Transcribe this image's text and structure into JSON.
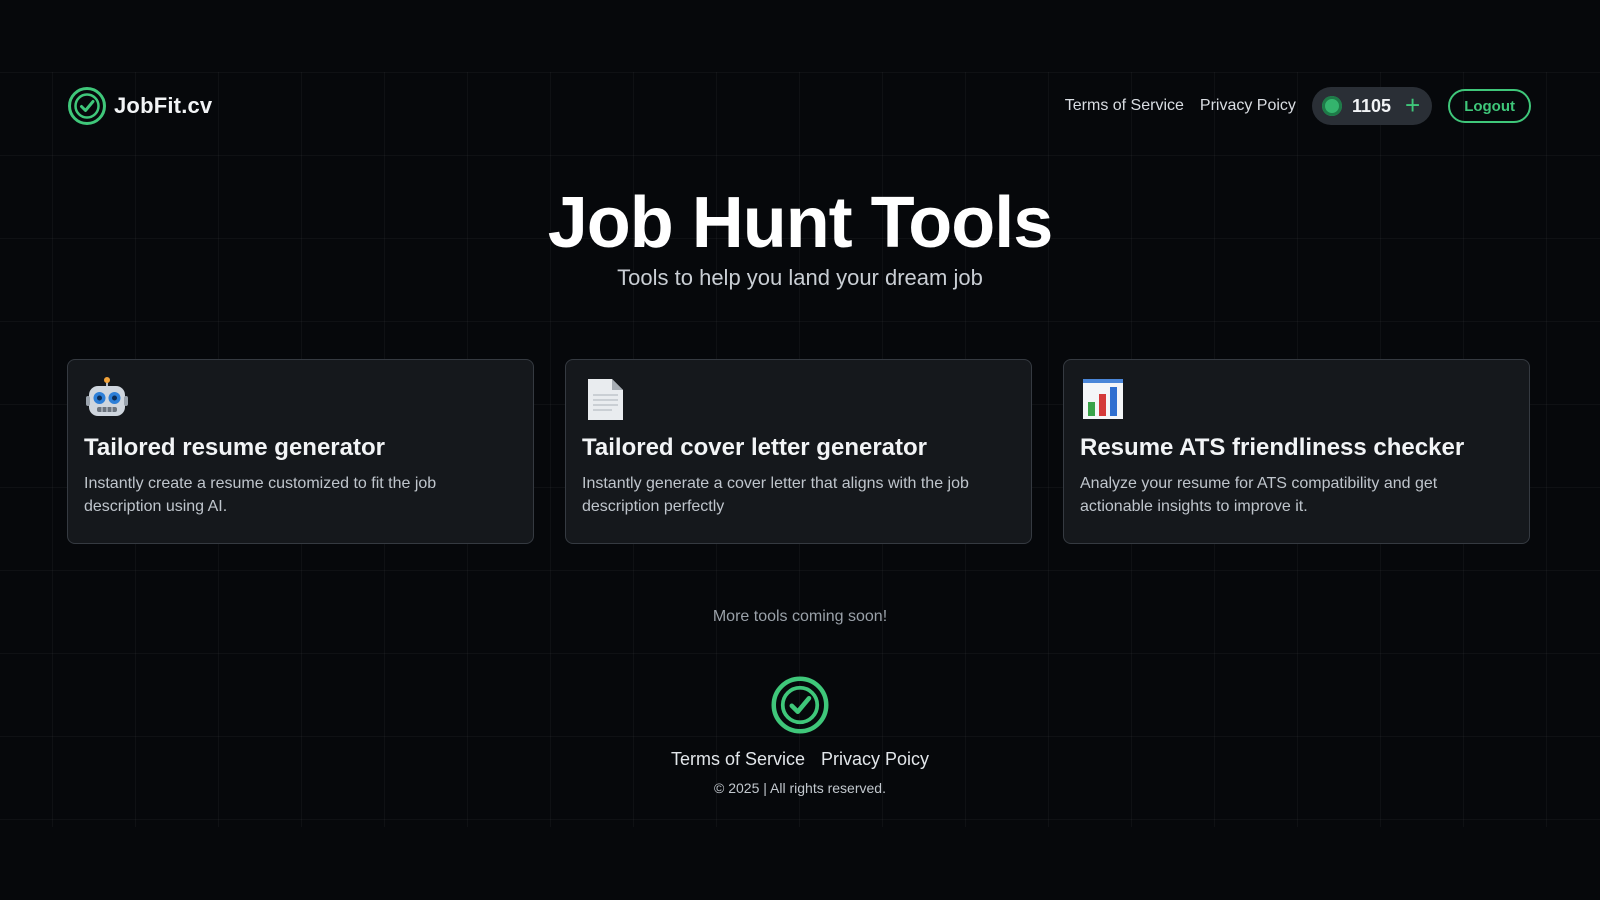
{
  "brand": {
    "name": "JobFit.cv"
  },
  "nav": {
    "terms_label": "Terms of Service",
    "privacy_label": "Privacy Poicy",
    "credits": "1105",
    "add_credits_glyph": "+",
    "logout_label": "Logout"
  },
  "hero": {
    "title": "Job Hunt Tools",
    "subtitle": "Tools to help you land your dream job"
  },
  "tools": [
    {
      "icon": "robot-icon",
      "title": "Tailored resume generator",
      "description": "Instantly create a resume customized to fit the job description using AI."
    },
    {
      "icon": "document-icon",
      "title": "Tailored cover letter generator",
      "description": "Instantly generate a cover letter that aligns with the job description perfectly"
    },
    {
      "icon": "bar-chart-icon",
      "title": "Resume ATS friendliness checker",
      "description": "Analyze your resume for ATS compatibility and get actionable insights to improve it."
    }
  ],
  "coming_soon": "More tools coming soon!",
  "footer": {
    "terms_label": "Terms of Service",
    "privacy_label": "Privacy Poicy",
    "copyright": "© 2025 | All rights reserved."
  },
  "colors": {
    "background": "#06080b",
    "accent": "#3fc77a",
    "card_background": "#15181c",
    "card_border": "#353a41"
  }
}
